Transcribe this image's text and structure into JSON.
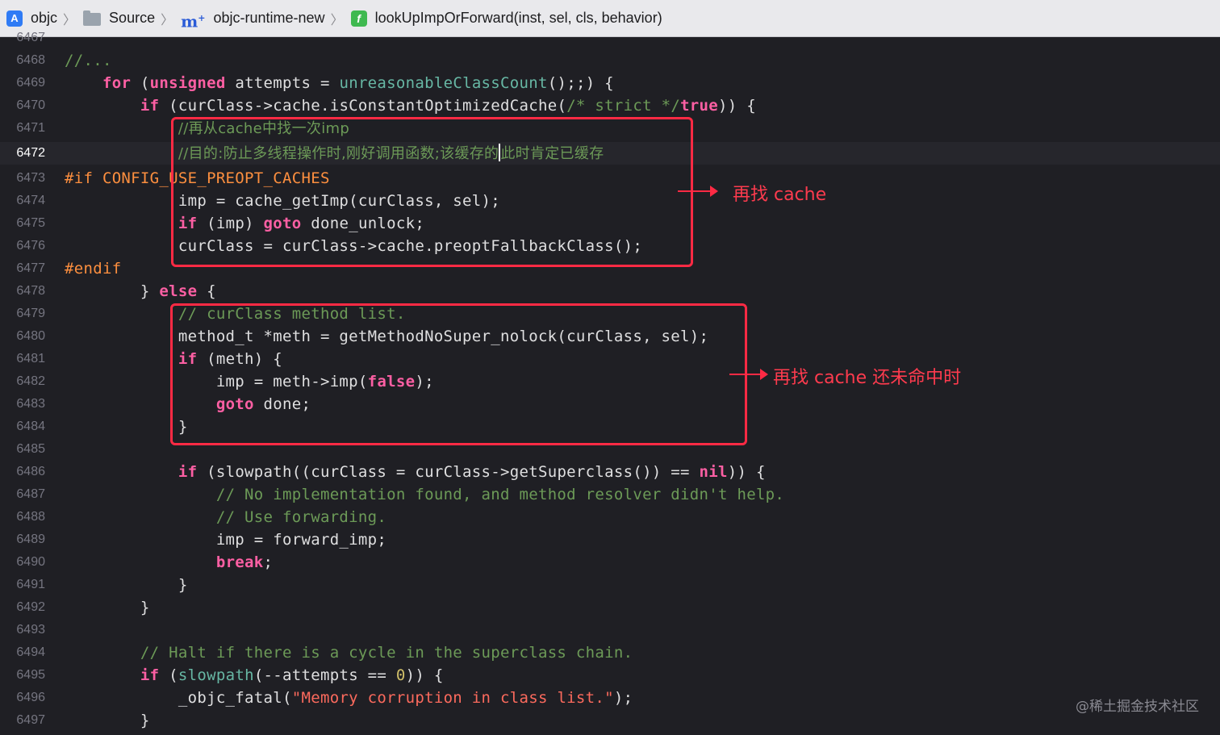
{
  "breadcrumb": {
    "items": [
      {
        "icon": "app-target-icon",
        "label": "objc"
      },
      {
        "icon": "folder-icon",
        "label": "Source"
      },
      {
        "icon": "objc-file-icon",
        "label": "objc-runtime-new"
      },
      {
        "icon": "function-icon",
        "label": "lookUpImpOrForward(inst, sel, cls, behavior)"
      }
    ]
  },
  "editor": {
    "current_line": "6472",
    "lines": [
      {
        "n": "6467",
        "html": ""
      },
      {
        "n": "6468",
        "html": "<span class=\"cm\">//...</span>"
      },
      {
        "n": "6469",
        "html": "    <span class=\"kw\">for</span> (<span class=\"kw\">unsigned</span> attempts = <span class=\"fn\">unreasonableClassCount</span>();;) {"
      },
      {
        "n": "6470",
        "html": "        <span class=\"kw\">if</span> (curClass-&gt;cache.isConstantOptimizedCache(<span class=\"cm\">/* strict */</span><span class=\"kw\">true</span>)) {"
      },
      {
        "n": "6471",
        "html": "            <span class=\"cmz\">//再从cache中找一次imp</span>"
      },
      {
        "n": "6472",
        "html": "            <span class=\"cmz\">//目的:防止多线程操作时,刚好调用函数;该缓存的<span class=\"cursor\"></span>此时肯定已缓存</span>"
      },
      {
        "n": "6473",
        "html": "<span class=\"pp\">#if CONFIG_USE_PREOPT_CACHES</span>"
      },
      {
        "n": "6474",
        "html": "            imp = cache_getImp(curClass, sel);"
      },
      {
        "n": "6475",
        "html": "            <span class=\"kw\">if</span> (imp) <span class=\"kw\">goto</span> done_unlock;"
      },
      {
        "n": "6476",
        "html": "            curClass = curClass-&gt;cache.preoptFallbackClass();"
      },
      {
        "n": "6477",
        "html": "<span class=\"pp\">#endif</span>"
      },
      {
        "n": "6478",
        "html": "        } <span class=\"kw\">else</span> {"
      },
      {
        "n": "6479",
        "html": "            <span class=\"cm\">// curClass method list.</span>"
      },
      {
        "n": "6480",
        "html": "            method_t *meth = getMethodNoSuper_nolock(curClass, sel);"
      },
      {
        "n": "6481",
        "html": "            <span class=\"kw\">if</span> (meth) {"
      },
      {
        "n": "6482",
        "html": "                imp = meth-&gt;imp(<span class=\"kw\">false</span>);"
      },
      {
        "n": "6483",
        "html": "                <span class=\"kw\">goto</span> done;"
      },
      {
        "n": "6484",
        "html": "            }"
      },
      {
        "n": "6485",
        "html": ""
      },
      {
        "n": "6486",
        "html": "            <span class=\"kw\">if</span> (slowpath((curClass = curClass-&gt;getSuperclass()) == <span class=\"kw\">nil</span>)) {"
      },
      {
        "n": "6487",
        "html": "                <span class=\"cm\">// No implementation found, and method resolver didn't help.</span>"
      },
      {
        "n": "6488",
        "html": "                <span class=\"cm\">// Use forwarding.</span>"
      },
      {
        "n": "6489",
        "html": "                imp = forward_imp;"
      },
      {
        "n": "6490",
        "html": "                <span class=\"kw\">break</span>;"
      },
      {
        "n": "6491",
        "html": "            }"
      },
      {
        "n": "6492",
        "html": "        }"
      },
      {
        "n": "6493",
        "html": ""
      },
      {
        "n": "6494",
        "html": "        <span class=\"cm\">// Halt if there is a cycle in the superclass chain.</span>"
      },
      {
        "n": "6495",
        "html": "        <span class=\"kw\">if</span> (<span class=\"fn\">slowpath</span>(--attempts == <span class=\"num\">0</span>)) {"
      },
      {
        "n": "6496",
        "html": "            _objc_fatal(<span class=\"str\">\"Memory corruption in class list.\"</span>);"
      },
      {
        "n": "6497",
        "html": "        }"
      }
    ]
  },
  "annotations": {
    "cache_label": "再找 cache",
    "method_list_label": "再找 cache 还未命中时",
    "box_color": "#ff2a44"
  },
  "watermark": "@稀土掘金技术社区"
}
